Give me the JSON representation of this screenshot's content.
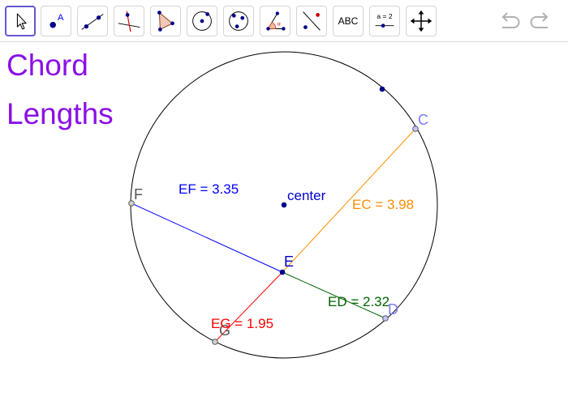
{
  "toolbar": {
    "tools": [
      {
        "id": "move",
        "selected": true
      },
      {
        "id": "point",
        "glyph_label": "A"
      },
      {
        "id": "line"
      },
      {
        "id": "perpendicular"
      },
      {
        "id": "polygon"
      },
      {
        "id": "circle-center"
      },
      {
        "id": "circle-three-points"
      },
      {
        "id": "angle",
        "glyph_label": "α"
      },
      {
        "id": "reflect"
      },
      {
        "id": "text",
        "label": "ABC"
      },
      {
        "id": "slider",
        "label": "a = 2"
      },
      {
        "id": "move-graphics"
      }
    ],
    "undo_icon": "undo-icon",
    "redo_icon": "redo-icon"
  },
  "title": {
    "line1": "Chord",
    "line2": "Lengths",
    "color": "#8b10e5"
  },
  "construction": {
    "point_labels": {
      "center": "center",
      "E": "E",
      "F": "F",
      "C": "C",
      "D": "D",
      "G": "G"
    },
    "measurements": {
      "EF": "EF = 3.35",
      "EC": "EC = 3.98",
      "ED": "ED = 2.32",
      "EG": "EG = 1.95"
    },
    "colors": {
      "EF": "#0000ff",
      "EC": "#ff8c00",
      "ED": "#006400",
      "EG": "#ff0000",
      "points": "#00008b",
      "endpoint_labels_CD": "#7b7bff",
      "endpoint_labels_FG": "#555555",
      "circle": "#000000"
    }
  }
}
